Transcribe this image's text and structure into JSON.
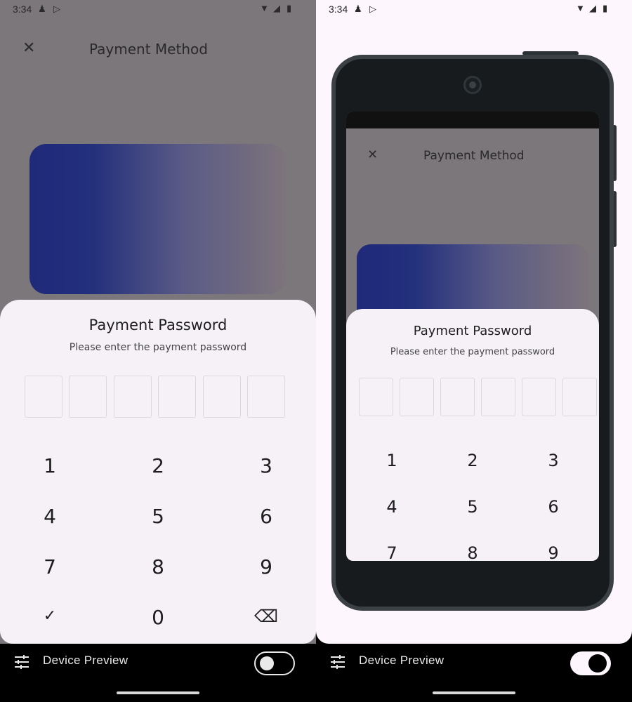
{
  "status_bar": {
    "time": "3:34",
    "icons_left": [
      "alarm-icon",
      "play-store-icon"
    ],
    "icons_right": [
      "wifi-icon",
      "signal-icon",
      "battery-icon"
    ]
  },
  "app": {
    "title": "Payment Method",
    "sheet": {
      "title": "Payment Password",
      "subtitle": "Please enter the payment password",
      "pin_length": 6
    },
    "keypad_left": [
      "1",
      "2",
      "3",
      "4",
      "5",
      "6",
      "7",
      "8",
      "9",
      "✓",
      "0",
      "⌫"
    ],
    "keypad_right": [
      "1",
      "2",
      "3",
      "4",
      "5",
      "6",
      "7",
      "8",
      "9"
    ]
  },
  "toolbar": {
    "label": "Device Preview",
    "left_toggle": "off",
    "right_toggle": "on"
  },
  "colors": {
    "scrim": "#7b777a",
    "card_start": "#1f2a7a",
    "card_end": "#7d747b",
    "sheet": "#f5f1f7",
    "frame": "#3a4044"
  }
}
